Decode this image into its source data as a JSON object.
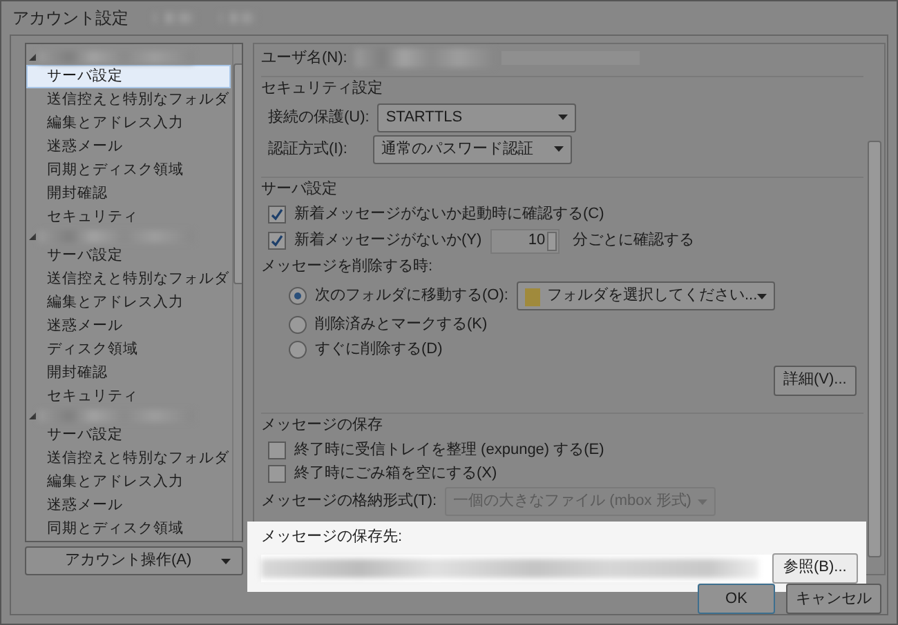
{
  "window": {
    "title": "アカウント設定"
  },
  "account_tree": [
    {
      "expanded": true,
      "children": [
        {
          "label": "サーバ設定",
          "selected": true
        },
        {
          "label": "送信控えと特別なフォルダ",
          "selected": false
        },
        {
          "label": "編集とアドレス入力",
          "selected": false
        },
        {
          "label": "迷惑メール",
          "selected": false
        },
        {
          "label": "同期とディスク領域",
          "selected": false
        },
        {
          "label": "開封確認",
          "selected": false
        },
        {
          "label": "セキュリティ",
          "selected": false
        }
      ]
    },
    {
      "expanded": true,
      "children": [
        {
          "label": "サーバ設定",
          "selected": false
        },
        {
          "label": "送信控えと特別なフォルダ",
          "selected": false
        },
        {
          "label": "編集とアドレス入力",
          "selected": false
        },
        {
          "label": "迷惑メール",
          "selected": false
        },
        {
          "label": "ディスク領域",
          "selected": false
        },
        {
          "label": "開封確認",
          "selected": false
        },
        {
          "label": "セキュリティ",
          "selected": false
        }
      ]
    },
    {
      "expanded": true,
      "children": [
        {
          "label": "サーバ設定",
          "selected": false
        },
        {
          "label": "送信控えと特別なフォルダ",
          "selected": false
        },
        {
          "label": "編集とアドレス入力",
          "selected": false
        },
        {
          "label": "迷惑メール",
          "selected": false
        },
        {
          "label": "同期とディスク領域",
          "selected": false
        }
      ]
    }
  ],
  "account_actions_button": "アカウント操作(A)",
  "username_label": "ユーザ名(N):",
  "security": {
    "title": "セキュリティ設定",
    "connection_label": "接続の保護(U):",
    "connection_value": "STARTTLS",
    "auth_label": "認証方式(I):",
    "auth_value": "通常のパスワード認証"
  },
  "server": {
    "title": "サーバ設定",
    "check_on_startup": {
      "label": "新着メッセージがないか起動時に確認する(C)",
      "checked": true
    },
    "check_every": {
      "label": "新着メッセージがないか(Y)",
      "checked": true,
      "minutes": "10",
      "suffix": "分ごとに確認する"
    },
    "delete_label": "メッセージを削除する時:",
    "delete_options": [
      {
        "kind": "folder",
        "label": "次のフォルダに移動する(O):",
        "selected": true,
        "folder": "フォルダを選択してください..."
      },
      {
        "kind": "plain",
        "label": "削除済みとマークする(K)",
        "selected": false
      },
      {
        "kind": "plain",
        "label": "すぐに削除する(D)",
        "selected": false
      }
    ],
    "advanced_button": "詳細(V)..."
  },
  "storage": {
    "title": "メッセージの保存",
    "options": [
      {
        "label": "終了時に受信トレイを整理 (expunge) する(E)",
        "checked": false
      },
      {
        "label": "終了時にごみ箱を空にする(X)",
        "checked": false
      }
    ],
    "format_label": "メッセージの格納形式(T):",
    "format_value": "一個の大きなファイル (mbox 形式)",
    "format_disabled": true,
    "location_label": "メッセージの保存先:",
    "browse_button": "参照(B)..."
  },
  "buttons": [
    "OK",
    "キャンセル"
  ]
}
